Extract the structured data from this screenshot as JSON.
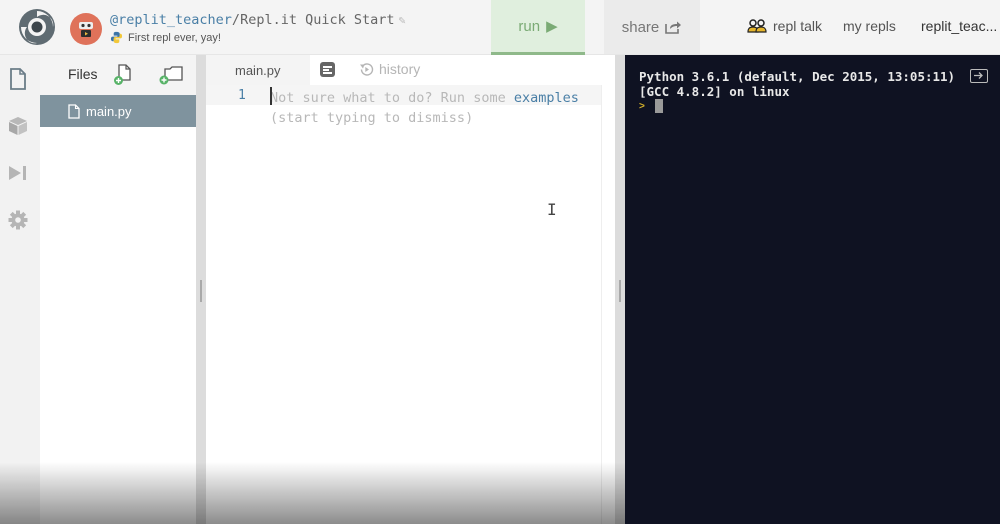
{
  "header": {
    "username": "@replit_teacher",
    "separator": "/",
    "repl_name": "Repl.it Quick Start",
    "description": "First repl ever, yay!",
    "run_label": "run",
    "share_label": "share",
    "nav": {
      "repl_talk": "repl talk",
      "my_repls": "my repls",
      "account": "replit_teac..."
    }
  },
  "rail": {
    "items": [
      "files",
      "packages",
      "debugger",
      "settings"
    ]
  },
  "files": {
    "title": "Files",
    "items": [
      {
        "name": "main.py",
        "selected": true
      }
    ]
  },
  "editor": {
    "tabs": {
      "active": "main.py",
      "history": "history"
    },
    "line_numbers": [
      "1"
    ],
    "placeholder_line1_prefix": "Not sure what to do? Run some ",
    "placeholder_link": "examples",
    "placeholder_line2": "(start typing to dismiss)"
  },
  "console": {
    "lines": [
      "Python 3.6.1 (default, Dec 2015, 13:05:11)",
      "[GCC 4.8.2] on linux"
    ],
    "prompt": ">"
  },
  "colors": {
    "run_bg": "#e0efde",
    "run_accent": "#8fb98a",
    "file_selected": "#7f939e",
    "link_blue": "#4a7fa6",
    "console_bg": "#0f1222",
    "prompt_yellow": "#d8b32a",
    "avatar": "#df725a"
  }
}
